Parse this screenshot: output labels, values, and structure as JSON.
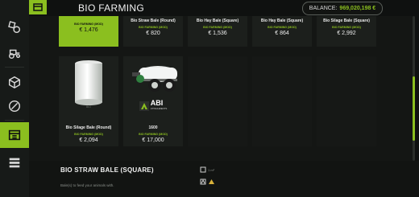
{
  "app": {
    "title": "BIO FARMING",
    "balance_label": "BALANCE:",
    "balance_value": "969,020,198 €"
  },
  "top_row": [
    {
      "name": "",
      "tag": "BIO FARMING (MOD)",
      "price": "€ 1,476",
      "selected": true
    },
    {
      "name": "Bio Straw Bale (Round)",
      "tag": "BIO FARMING (MOD)",
      "price": "€ 820"
    },
    {
      "name": "Bio Hay Bale (Square)",
      "tag": "BIO FARMING (MOD)",
      "price": "€ 1,536"
    },
    {
      "name": "Bio Hay Bale (Square)",
      "tag": "BIO FARMING (MOD)",
      "price": "€ 864"
    },
    {
      "name": "Bio Silage Bale (Square)",
      "tag": "BIO FARMING (MOD)",
      "price": "€ 2,992"
    }
  ],
  "second_row": [
    {
      "name": "Bio Silage Bale (Round)",
      "tag": "BIO FARMING (MOD)",
      "price": "€ 2,094",
      "image_label": "BIO",
      "icon": "round-bale-icon"
    },
    {
      "name": "1600",
      "tag": "BIO FARMING (MOD)",
      "price": "€ 17,000",
      "brand": "ABI",
      "brand_sub": "ATTACHMENTS",
      "icon": "manure-spreader-icon"
    }
  ],
  "details": {
    "title": "BIO STRAW BALE (SQUARE)",
    "description": "Bale(s) to feed your animals with.",
    "stat1": "1 m³",
    "stat2": ""
  },
  "colors": {
    "accent": "#8bbf1f",
    "background": "#0f1110"
  }
}
